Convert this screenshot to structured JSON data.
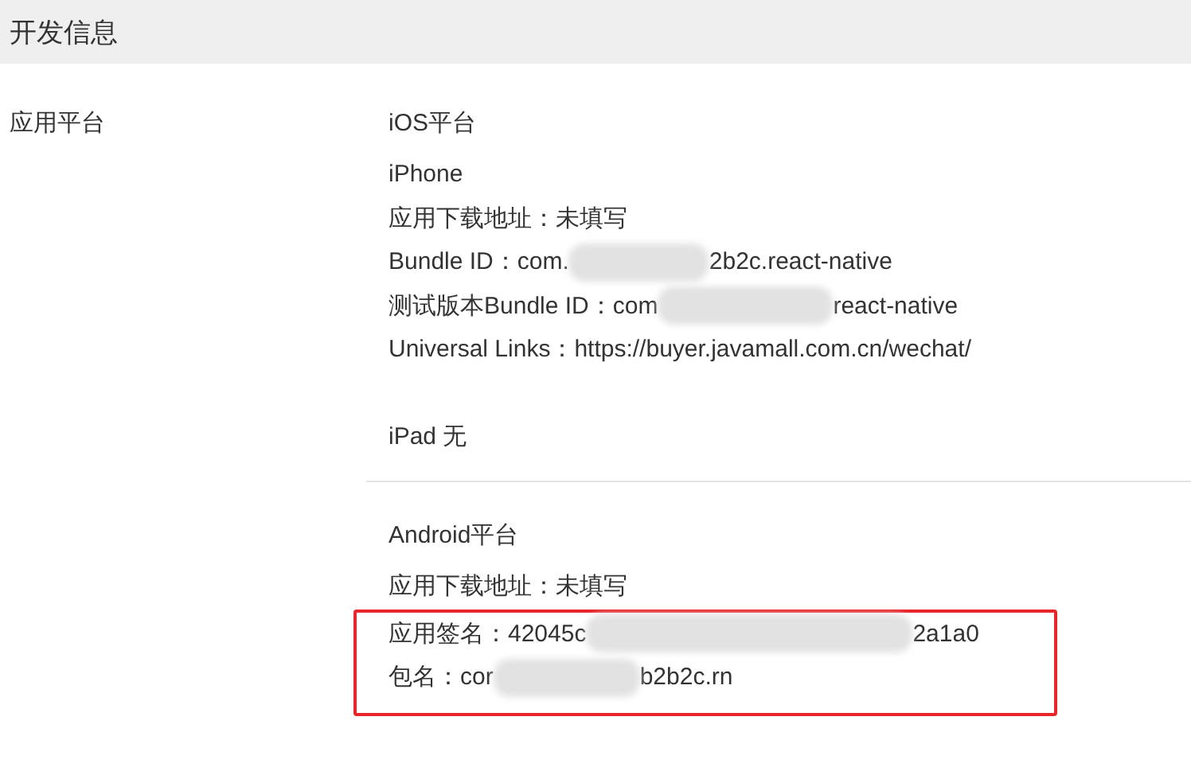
{
  "section_header": {
    "title": "开发信息"
  },
  "field": {
    "label": "应用平台"
  },
  "ios": {
    "title": "iOS平台",
    "device": "iPhone",
    "lines": [
      {
        "parts": [
          "应用下载地址：未填写"
        ]
      },
      {
        "parts": [
          "Bundle ID：com.",
          "2b2c.react-native"
        ]
      },
      {
        "parts": [
          "测试版本Bundle ID：com",
          "react-native"
        ]
      },
      {
        "parts": [
          "Universal Links：https://buyer.javamall.com.cn/wechat/"
        ]
      }
    ],
    "ipad": "iPad 无"
  },
  "android": {
    "title": "Android平台",
    "lines": [
      {
        "parts": [
          "应用下载地址：未填写"
        ],
        "highlighted": false
      },
      {
        "parts": [
          "应用签名：42045c",
          "2a1a0"
        ],
        "highlighted": true
      },
      {
        "parts": [
          "包名：cor",
          "b2b2c.rn"
        ],
        "highlighted": true
      }
    ]
  }
}
